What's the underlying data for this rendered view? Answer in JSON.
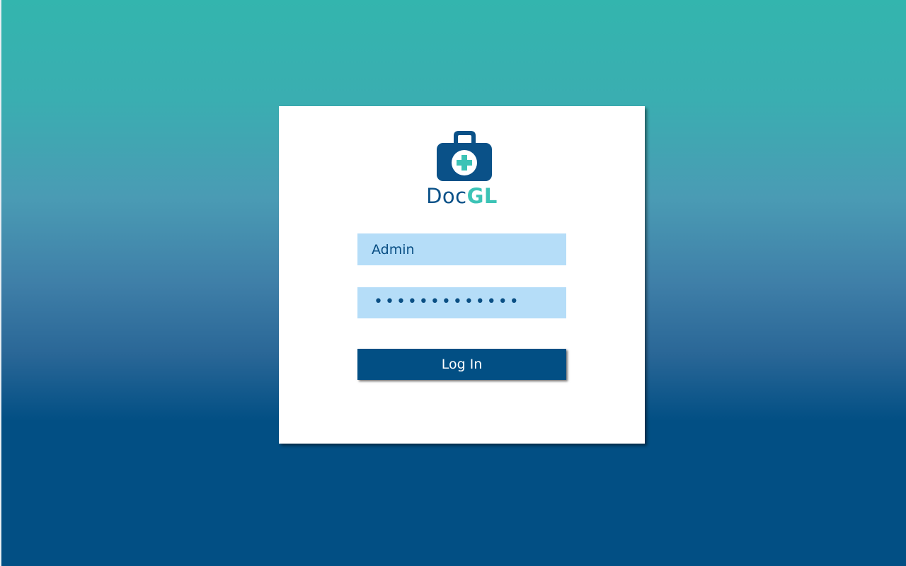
{
  "brand": {
    "name_part1": "Doc",
    "name_part2": "GL",
    "logo_icon": "medical-kit-icon",
    "color_primary": "#0a5188",
    "color_accent": "#3cc3b6"
  },
  "login": {
    "username_value": "Admin",
    "password_masked": "•••••••••••••",
    "submit_label": "Log In"
  },
  "colors": {
    "background_top": "#33b5ae",
    "background_bottom": "#024f84",
    "field_background": "#b5ddf8",
    "button_background": "#024f84"
  }
}
